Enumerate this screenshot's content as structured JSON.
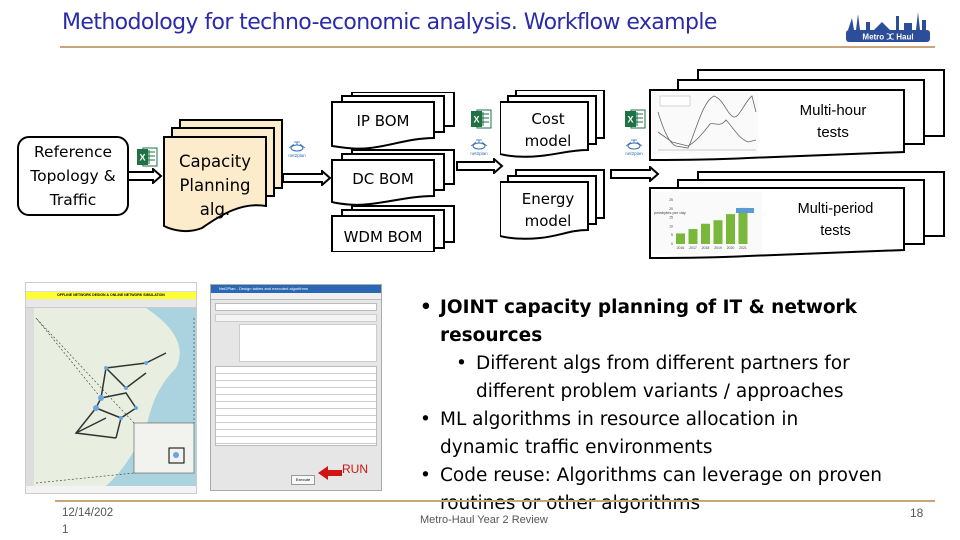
{
  "slide": {
    "title": "Methodology for techno-economic analysis. Workflow example",
    "logo_text": "Metro Haul",
    "logo_icon": "metro-haul-logo"
  },
  "workflow": {
    "input_box": "Reference Topology & Traffic",
    "input_lines": [
      "Reference",
      "Topology &",
      "Traffic"
    ],
    "capacity_alg_lines": [
      "Capacity",
      "Planning",
      "alg."
    ],
    "bom_items": [
      "IP BOM",
      "DC BOM",
      "WDM BOM"
    ],
    "cost_lines": [
      "Cost",
      "model"
    ],
    "energy_lines": [
      "Energy",
      "model"
    ],
    "multihour_lines": [
      "Multi-hour",
      "tests"
    ],
    "multiperiod_lines": [
      "Multi-period",
      "tests"
    ],
    "excel_icon_label": "X",
    "net2plan_icon_label": "net2plan"
  },
  "multiperiod_chart": {
    "ylabel": "petabytes per day",
    "categories": [
      "2016",
      "2017",
      "2018",
      "2019",
      "2020",
      "2021"
    ],
    "values": [
      6,
      8.5,
      11.5,
      13.5,
      17,
      20.5
    ],
    "ylim": [
      0,
      25
    ],
    "yticks": [
      "0",
      "5",
      "10",
      "15",
      "20",
      "25"
    ]
  },
  "screenshots": {
    "gui_banner": "OFFLINE NETWORK DESIGN & ONLINE NETWORK SIMULATION",
    "dialog_title": "Net2Plan - Design tables and executed algorithms",
    "run_label": "RUN",
    "execute_button": "Execute"
  },
  "bullets": [
    {
      "level": 1,
      "bold": true,
      "text": "JOINT capacity planning of IT & network resources"
    },
    {
      "level": 2,
      "bold": false,
      "text": "Different algs from different partners for different problem variants / approaches"
    },
    {
      "level": 1,
      "bold": false,
      "text": "ML algorithms in resource allocation in dynamic traffic environments"
    },
    {
      "level": 1,
      "bold": false,
      "text": "Code reuse: Algorithms can leverage on proven routines or other algorithms"
    }
  ],
  "footer": {
    "date_line1": "12/14/202",
    "date_line2": "1",
    "center": "Metro-Haul Year 2 Review",
    "page": "18"
  },
  "colors": {
    "title": "#2b2ba8",
    "rule": "#c8a57a",
    "doc_fill": "#fdeccb",
    "excel_green": "#1f7244",
    "chart_green": "#7ab83c",
    "run_red": "#d01414",
    "logo_blue": "#2c4d9a"
  }
}
